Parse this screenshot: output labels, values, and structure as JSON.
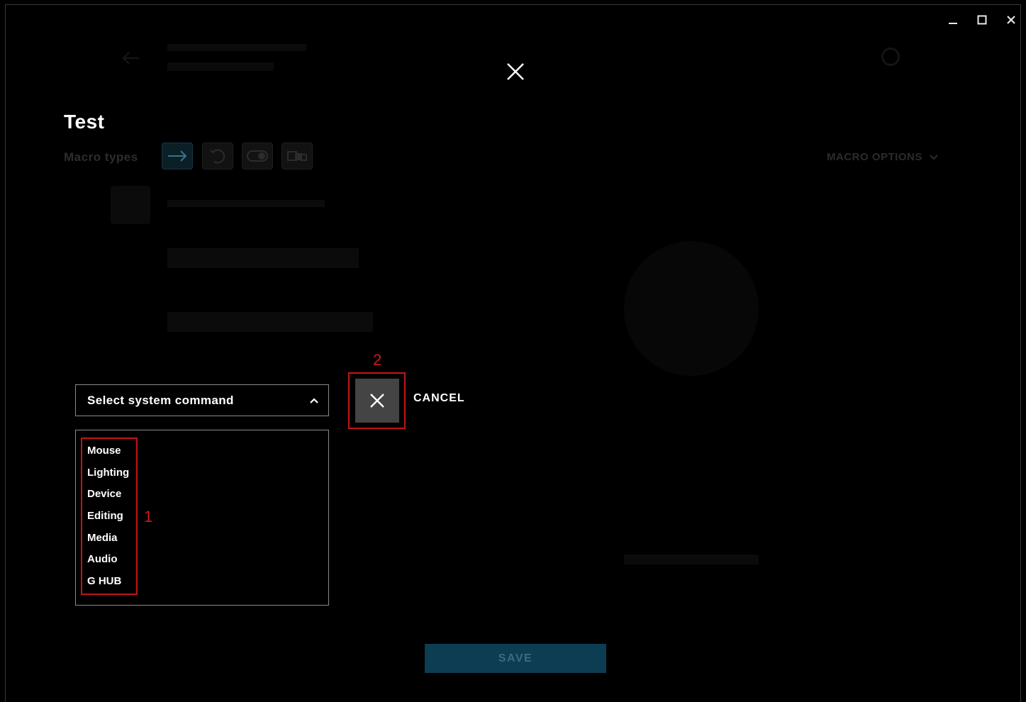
{
  "window": {
    "minimize_icon": "minimize-icon",
    "maximize_icon": "maximize-icon",
    "close_icon": "close-icon"
  },
  "overlay": {
    "close_icon": "close-icon"
  },
  "editor": {
    "title": "Test",
    "macro_types_label": "Macro types",
    "macro_type_buttons": [
      "arrow-right-icon",
      "loop-icon",
      "toggle-icon",
      "sequence-icon"
    ],
    "macro_options_label": "MACRO OPTIONS"
  },
  "system_command": {
    "select_placeholder": "Select system command",
    "options": [
      "Mouse",
      "Lighting",
      "Device",
      "Editing",
      "Media",
      "Audio",
      "G HUB"
    ]
  },
  "annotations": {
    "list_marker": "1",
    "cancel_marker": "2"
  },
  "actions": {
    "cancel_label": "CANCEL",
    "save_label": "SAVE"
  },
  "colors": {
    "background": "#000000",
    "annotation": "#c41414",
    "save_button": "#0c3d52",
    "cancel_button": "#444444"
  }
}
